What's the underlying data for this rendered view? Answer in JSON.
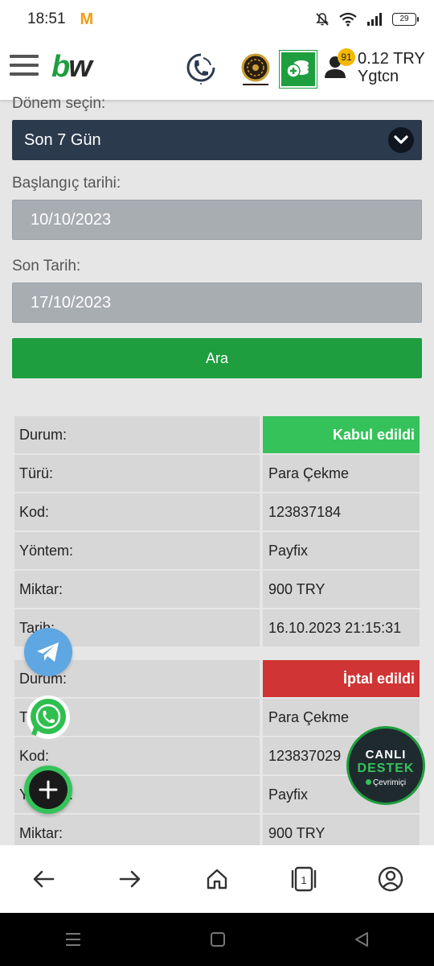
{
  "status_bar": {
    "time": "18:51",
    "app_badge": "M",
    "battery": "29"
  },
  "header": {
    "logo_b": "b",
    "logo_w": "w",
    "notification_count": "91",
    "balance": "0.12 TRY",
    "username": "Ygtcn"
  },
  "filter": {
    "period_label": "Dönem seçin:",
    "period_value": "Son 7 Gün",
    "start_label": "Başlangıç tarihi:",
    "start_value": "10/10/2023",
    "end_label": "Son Tarih:",
    "end_value": "17/10/2023",
    "search_button": "Ara"
  },
  "transactions": [
    {
      "status_label": "Durum:",
      "status_value": "Kabul edildi",
      "type_label": "Türü:",
      "type_value": "Para Çekme",
      "code_label": "Kod:",
      "code_value": "123837184",
      "method_label": "Yöntem:",
      "method_value": "Payfix",
      "amount_label": "Miktar:",
      "amount_value": "900 TRY",
      "date_label": "Tarih:",
      "date_value": "16.10.2023 21:15:31"
    },
    {
      "status_label": "Durum:",
      "status_value": "İptal edildi",
      "type_label": "Türü:",
      "type_value": "Para Çekme",
      "code_label": "Kod:",
      "code_value": "123837029",
      "method_label": "Yöntem:",
      "method_value": "Payfix",
      "amount_label": "Miktar:",
      "amount_value": "900 TRY"
    }
  ],
  "support": {
    "line1": "CANLI",
    "line2": "DESTEK",
    "line3": "Çevrimiçi"
  },
  "browser_nav": {
    "tab_count": "1"
  },
  "icons": [
    "menu-icon",
    "phone-icon",
    "wheel-icon",
    "coins-icon",
    "user-icon",
    "chevron-down-icon",
    "telegram-icon",
    "whatsapp-icon",
    "plus-icon",
    "back-arrow-icon",
    "forward-arrow-icon",
    "home-icon",
    "tabs-icon",
    "account-icon"
  ],
  "colors": {
    "brand_green": "#1e9e3e",
    "accepted": "#35c25a",
    "cancelled": "#d03434",
    "select_bg": "#2c3a4e"
  }
}
